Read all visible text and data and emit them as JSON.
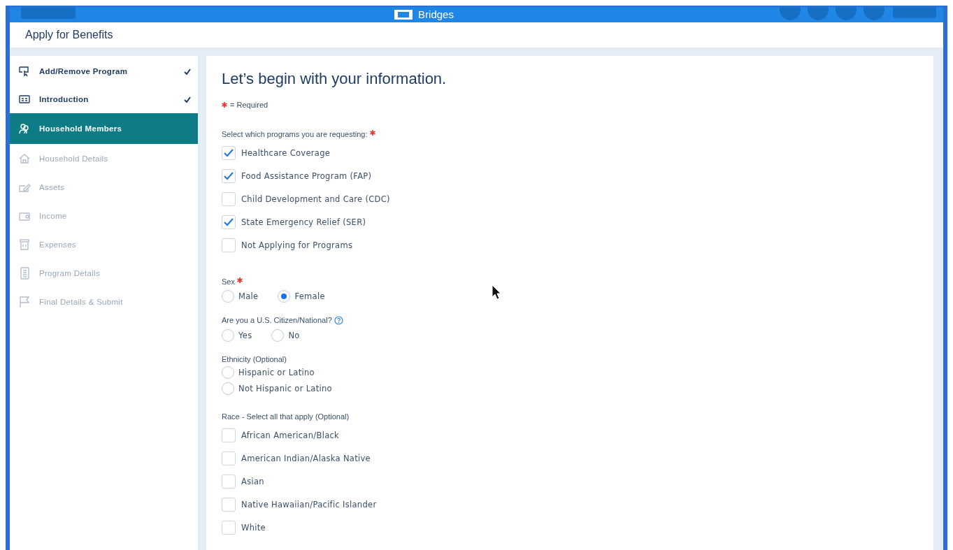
{
  "header": {
    "logo": "Bridges"
  },
  "page_title": "Apply for Benefits",
  "sidebar": {
    "items": [
      {
        "label": "Add/Remove Program",
        "completed": true,
        "selected": false,
        "disabled": false
      },
      {
        "label": "Introduction",
        "completed": true,
        "selected": false,
        "disabled": false
      },
      {
        "label": "Household Members",
        "completed": false,
        "selected": true,
        "disabled": false
      },
      {
        "label": "Household Details",
        "completed": false,
        "selected": false,
        "disabled": true
      },
      {
        "label": "Assets",
        "completed": false,
        "selected": false,
        "disabled": true
      },
      {
        "label": "Income",
        "completed": false,
        "selected": false,
        "disabled": true
      },
      {
        "label": "Expenses",
        "completed": false,
        "selected": false,
        "disabled": true
      },
      {
        "label": "Program Details",
        "completed": false,
        "selected": false,
        "disabled": true
      },
      {
        "label": "Final Details & Submit",
        "completed": false,
        "selected": false,
        "disabled": true
      }
    ]
  },
  "form": {
    "heading": "Let’s begin with your information.",
    "required_note": "= Required",
    "sections": [
      {
        "kind": "checkboxes",
        "label": "Select which programs you are requesting:",
        "required": true,
        "help": false,
        "options": [
          {
            "label": "Healthcare Coverage",
            "checked": true
          },
          {
            "label": "Food Assistance Program (FAP)",
            "checked": true
          },
          {
            "label": "Child Development and Care (CDC)",
            "checked": false
          },
          {
            "label": "State Emergency Relief (SER)",
            "checked": true
          },
          {
            "label": "Not Applying for Programs",
            "checked": false
          }
        ]
      },
      {
        "kind": "radio_row",
        "label": "Sex",
        "required": true,
        "help": false,
        "options": [
          {
            "label": "Male",
            "selected": false
          },
          {
            "label": "Female",
            "selected": true
          }
        ]
      },
      {
        "kind": "radio_row",
        "label": "Are you a U.S. Citizen/National?",
        "required": false,
        "help": true,
        "options": [
          {
            "label": "Yes",
            "selected": false
          },
          {
            "label": "No",
            "selected": false
          }
        ]
      },
      {
        "kind": "radio_column",
        "label": "Ethnicity (Optional)",
        "required": false,
        "help": false,
        "options": [
          {
            "label": "Hispanic or Latino",
            "selected": false
          },
          {
            "label": "Not Hispanic or Latino",
            "selected": false
          }
        ]
      },
      {
        "kind": "checkboxes",
        "label": "Race - Select all that apply (Optional)",
        "required": false,
        "help": false,
        "options": [
          {
            "label": "African American/Black",
            "checked": false
          },
          {
            "label": "American Indian/Alaska Native",
            "checked": false
          },
          {
            "label": "Asian",
            "checked": false
          },
          {
            "label": "Native Hawaiian/Pacific Islander",
            "checked": false
          },
          {
            "label": "White",
            "checked": false
          }
        ]
      }
    ]
  }
}
